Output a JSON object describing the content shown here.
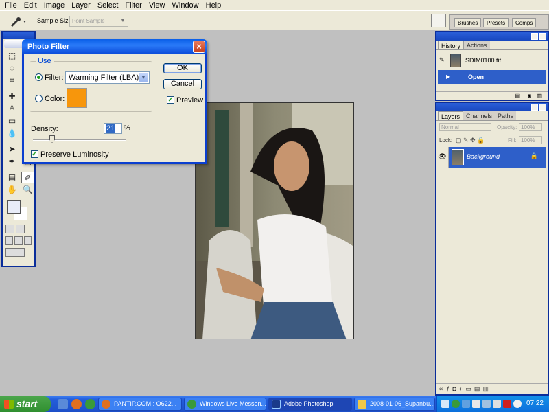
{
  "menubar": {
    "items": [
      "File",
      "Edit",
      "Image",
      "Layer",
      "Select",
      "Filter",
      "View",
      "Window",
      "Help"
    ]
  },
  "options_bar": {
    "sample_size_label": "Sample Size:",
    "sample_size_value": "Point Sample",
    "well_tabs": [
      "Brushes",
      "Presets",
      "Comps"
    ]
  },
  "dialog": {
    "title": "Photo Filter",
    "use_group_label": "Use",
    "filter_label": "Filter:",
    "filter_value": "Warming Filter (LBA)",
    "color_label": "Color:",
    "color_swatch": "#f7960c",
    "ok_label": "OK",
    "cancel_label": "Cancel",
    "preview_label": "Preview",
    "density_label": "Density:",
    "density_value": "21",
    "density_unit": "%",
    "preserve_label": "Preserve Luminosity",
    "filter_selected": true,
    "preview_checked": true,
    "preserve_checked": true
  },
  "history_panel": {
    "tabs": [
      "History",
      "Actions"
    ],
    "snapshot_name": "SDIM0100.tif",
    "states": [
      "Open"
    ]
  },
  "layers_panel": {
    "tabs": [
      "Layers",
      "Channels",
      "Paths"
    ],
    "blend_mode": "Normal",
    "opacity_label": "Opacity:",
    "opacity_value": "100%",
    "lock_label": "Lock:",
    "fill_label": "Fill:",
    "fill_value": "100%",
    "layers": [
      "Background"
    ]
  },
  "taskbar": {
    "start_label": "start",
    "tasks": [
      "PANTIP.COM : O622...",
      "Windows Live Messen...",
      "Adobe Photoshop",
      "2008-01-06_Supanbu..."
    ],
    "active_task": "Adobe Photoshop",
    "clock": "07:22"
  },
  "colors": {
    "title_blue": "#0b4ad8",
    "dialog_bg": "#ece9d8",
    "warm_swatch": "#f7960c",
    "selection_blue": "#2e5fc9"
  }
}
